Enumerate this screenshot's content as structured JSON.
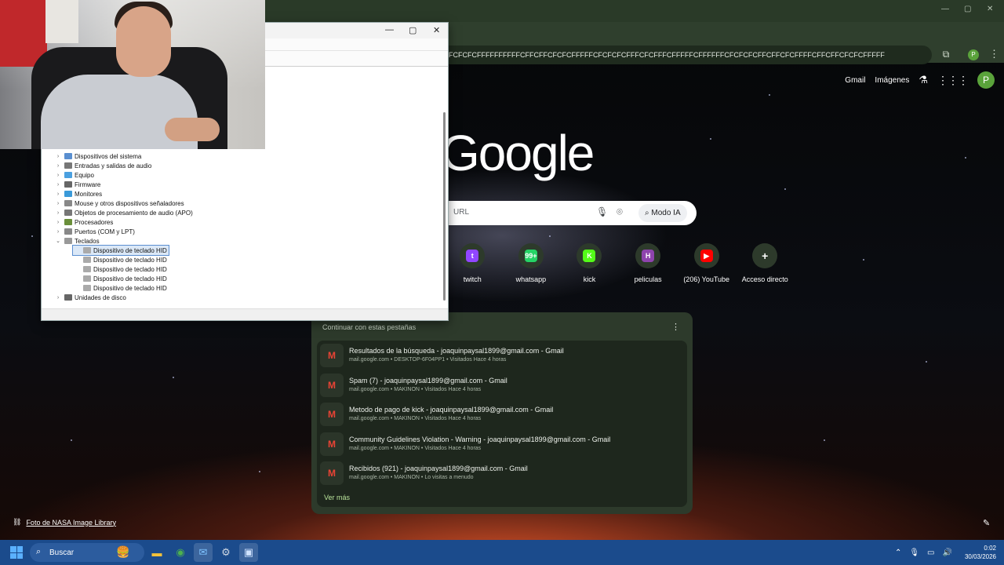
{
  "browser": {
    "omnibox_text": "FCFCFCFFFFFFFFFFCFFCFFCFCFCFFFFFCFCFCFCFFFCFCFFFCFFFFFCFFFFFFCFCFCFCFFCFFCFCFFFFCFFCFFCFCFCFFFFF",
    "profile_initial": "P",
    "top_links": {
      "gmail": "Gmail",
      "images": "Imágenes"
    },
    "logo_text": "Google",
    "search": {
      "placeholder": "URL",
      "mode_ia": "Modo IA"
    },
    "shortcuts": [
      {
        "label": "twitch",
        "glyph": "t",
        "color": "#9146ff"
      },
      {
        "label": "whatsapp",
        "glyph": "99+",
        "color": "#25d366"
      },
      {
        "label": "kick",
        "glyph": "K",
        "color": "#53fc18"
      },
      {
        "label": "peliculas",
        "glyph": "H",
        "color": "#8e44ad"
      },
      {
        "label": "(206) YouTube",
        "glyph": "▶",
        "color": "#ff0000"
      },
      {
        "label": "Acceso directo",
        "glyph": "+",
        "color": "#2d3a2b"
      }
    ],
    "continue_tabs": {
      "title": "Continuar con estas pestañas",
      "items": [
        {
          "title": "Resultados de la búsqueda - joaquinpaysal1899@gmail.com - Gmail",
          "sub": "mail.google.com • DESKTOP-6F04PP1 • Visitados Hace 4 horas"
        },
        {
          "title": "Spam (7) - joaquinpaysal1899@gmail.com - Gmail",
          "sub": "mail.google.com • MAKINON • Visitados Hace 4 horas"
        },
        {
          "title": "Metodo de pago de kick - joaquinpaysal1899@gmail.com - Gmail",
          "sub": "mail.google.com • MAKINON • Visitados Hace 4 horas"
        },
        {
          "title": "Community Guidelines Violation - Warning - joaquinpaysal1899@gmail.com - Gmail",
          "sub": "mail.google.com • MAKINON • Visitados Hace 4 horas"
        },
        {
          "title": "Recibidos (921) - joaquinpaysal1899@gmail.com - Gmail",
          "sub": "mail.google.com • MAKINON • Lo visitas a menudo"
        }
      ],
      "more": "Ver más"
    },
    "credit": "Foto de NASA Image Library"
  },
  "device_manager": {
    "nodes": [
      {
        "label": "Dispositivos del sistema",
        "level": 0,
        "expander": "›",
        "icon": "#5a8fd0"
      },
      {
        "label": "Entradas y salidas de audio",
        "level": 0,
        "expander": "›",
        "icon": "#777"
      },
      {
        "label": "Equipo",
        "level": 0,
        "expander": "›",
        "icon": "#4aa0e0"
      },
      {
        "label": "Firmware",
        "level": 0,
        "expander": "›",
        "icon": "#666"
      },
      {
        "label": "Monitores",
        "level": 0,
        "expander": "›",
        "icon": "#3a9ad9"
      },
      {
        "label": "Mouse y otros dispositivos señaladores",
        "level": 0,
        "expander": "›",
        "icon": "#888"
      },
      {
        "label": "Objetos de procesamiento de audio (APO)",
        "level": 0,
        "expander": "›",
        "icon": "#777"
      },
      {
        "label": "Procesadores",
        "level": 0,
        "expander": "›",
        "icon": "#6a8f3a"
      },
      {
        "label": "Puertos (COM y LPT)",
        "level": 0,
        "expander": "›",
        "icon": "#888"
      },
      {
        "label": "Teclados",
        "level": 0,
        "expander": "⌄",
        "icon": "#999"
      },
      {
        "label": "Dispositivo de teclado HID",
        "level": 1,
        "expander": "",
        "icon": "#aaa",
        "selected": true
      },
      {
        "label": "Dispositivo de teclado HID",
        "level": 1,
        "expander": "",
        "icon": "#aaa"
      },
      {
        "label": "Dispositivo de teclado HID",
        "level": 1,
        "expander": "",
        "icon": "#aaa"
      },
      {
        "label": "Dispositivo de teclado HID",
        "level": 1,
        "expander": "",
        "icon": "#aaa"
      },
      {
        "label": "Dispositivo de teclado HID",
        "level": 1,
        "expander": "",
        "icon": "#aaa"
      },
      {
        "label": "Unidades de disco",
        "level": 0,
        "expander": "›",
        "icon": "#666"
      }
    ]
  },
  "taskbar": {
    "search_label": "Buscar",
    "clock_time": "0:02",
    "clock_date": "30/03/2026"
  }
}
